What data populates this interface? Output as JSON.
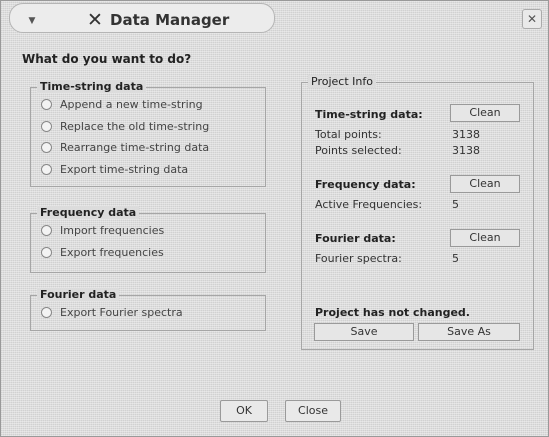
{
  "window": {
    "title": "Data Manager",
    "menu_icon": "chevron-down-icon",
    "app_icon": "close-x-icon",
    "close_icon": "close-icon"
  },
  "question": "What do you want to do?",
  "time_string_group": {
    "title": "Time-string data",
    "options": [
      "Append a new time-string",
      "Replace the old time-string",
      "Rearrange time-string data",
      "Export time-string data"
    ]
  },
  "frequency_group": {
    "title": "Frequency data",
    "options": [
      "Import frequencies",
      "Export frequencies"
    ]
  },
  "fourier_group": {
    "title": "Fourier data",
    "options": [
      "Export Fourier spectra"
    ]
  },
  "project_info": {
    "title": "Project Info",
    "time_string": {
      "heading": "Time-string data:",
      "clean_label": "Clean",
      "total_points_label": "Total points:",
      "total_points_value": "3138",
      "points_selected_label": "Points selected:",
      "points_selected_value": "3138"
    },
    "frequency": {
      "heading": "Frequency data:",
      "clean_label": "Clean",
      "active_label": "Active Frequencies:",
      "active_value": "5"
    },
    "fourier": {
      "heading": "Fourier data:",
      "clean_label": "Clean",
      "spectra_label": "Fourier spectra:",
      "spectra_value": "5"
    },
    "status": "Project has not changed.",
    "save_label": "Save",
    "save_as_label": "Save As"
  },
  "footer": {
    "ok_label": "OK",
    "close_label": "Close"
  }
}
